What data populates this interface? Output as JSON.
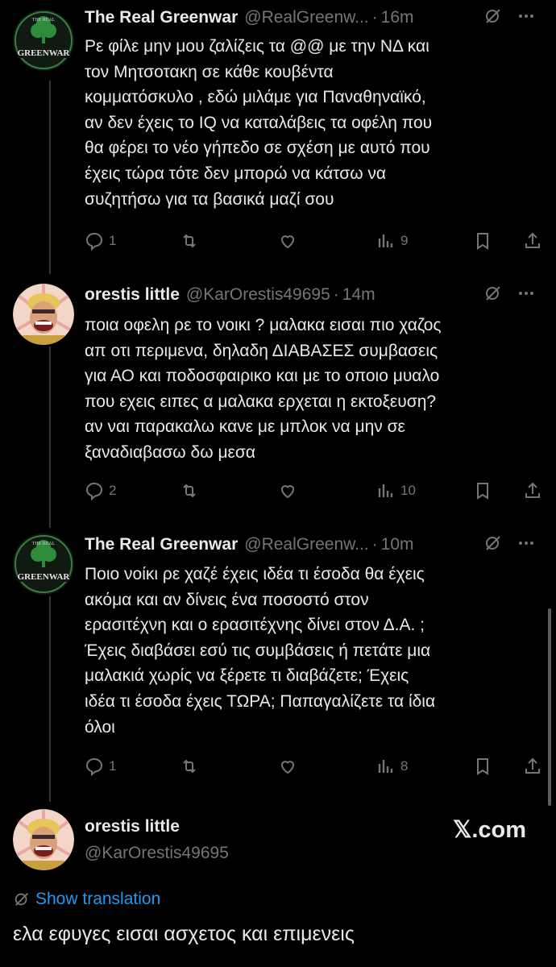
{
  "tweets": [
    {
      "name": "The Real Greenwar",
      "handle": "@RealGreenw...",
      "sep": "·",
      "time": "16m",
      "avatar": "greenwar-logo",
      "avatar_text_top": "THE REAL",
      "avatar_text_bottom": "GREENWAR",
      "text": "Ρε φίλε μην μου ζαλίζεις τα @@ με την ΝΔ και\nτον Μητσοτακη σε κάθε κουβέντα\nκομματόσκυλο , εδώ μιλάμε για Παναθηναϊκό,\nαν δεν έχεις το IQ να καταλάβεις τα οφέλη που\nθα φέρει το νέο γήπεδο σε σχέση με αυτό που\nέχεις τώρα τότε δεν μπορώ να κάτσω να\nσυζητήσω για τα βασικά μαζί σου",
      "replies": "1",
      "reposts": "",
      "likes": "",
      "views": "9"
    },
    {
      "name": "orestis little",
      "handle": "@KarOrestis49695",
      "sep": "·",
      "time": "14m",
      "avatar": "cartoon-avatar",
      "text": "ποια οφελη ρε το νοικι ? μαλακα εισαι πιο χαζος\nαπ οτι περιμενα, δηλαδη ΔΙΑΒΑΣΕΣ συμβασεις\nγια ΑΟ και ποδοσφαιρικο και με το οποιο μυαλο\nπου εχεις ειπες α μαλακα ερχεται η εκτοξευση?\nαν ναι παρακαλω κανε με μπλοκ να μην σε\nξαναδιαβασω δω μεσα",
      "replies": "2",
      "reposts": "",
      "likes": "",
      "views": "10"
    },
    {
      "name": "The Real Greenwar",
      "handle": "@RealGreenw...",
      "sep": "·",
      "time": "10m",
      "avatar": "greenwar-logo",
      "avatar_text_top": "THE REAL",
      "avatar_text_bottom": "GREENWAR",
      "text": "Ποιο νοίκι ρε χαζέ έχεις ιδέα τι έσοδα θα έχεις\nακόμα και αν δίνεις ένα ποσοστό στον\nερασιτέχνη  και ο ερασιτέχνης δίνει στον Δ.Α. ;\nΈχεις διαβάσει εσύ τις συμβάσεις ή πετάτε μια\nμαλακιά χωρίς να ξέρετε τι διαβάζετε;  Έχεις\nιδέα τι έσοδα έχεις ΤΩΡΑ; Παπαγαλίζετε τα ίδια\nόλοι",
      "replies": "1",
      "reposts": "",
      "likes": "",
      "views": "8"
    }
  ],
  "main_tweet": {
    "name": "orestis little",
    "handle": "@KarOrestis49695",
    "avatar": "cartoon-avatar",
    "translate_label": "Show translation",
    "text": "ελα εφυγες εισαι ασχετος και επιμενεις"
  },
  "watermark": "𝕏.com",
  "colors": {
    "background": "#000000",
    "text": "#e7e9ea",
    "muted": "#71767b",
    "link": "#1d9bf0",
    "logo_green": "#2e8b3a"
  }
}
